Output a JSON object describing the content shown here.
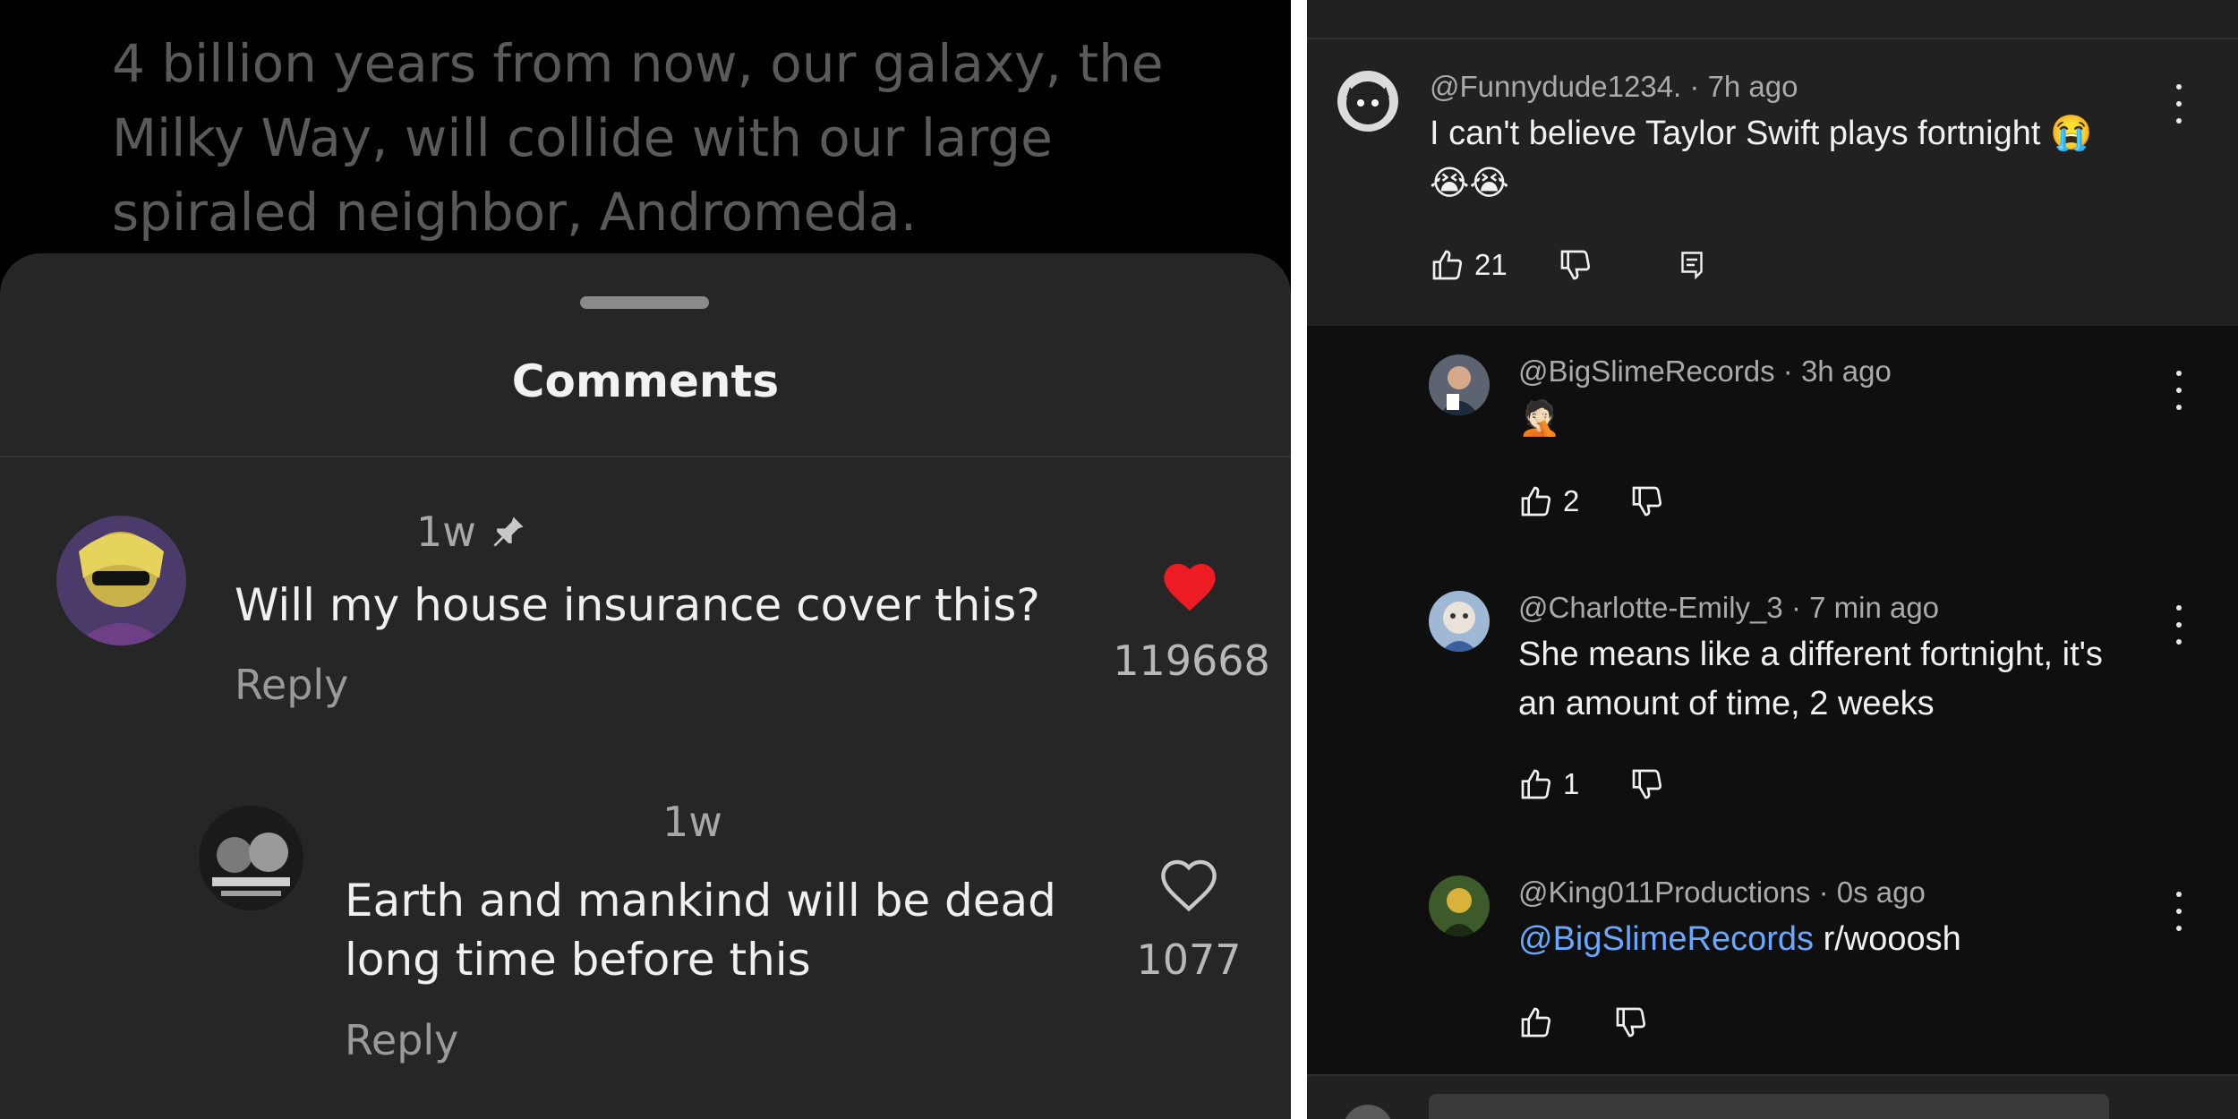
{
  "left": {
    "post_text": "4 billion years from now, our galaxy, the Milky Way, will collide with our large spiraled neighbor, Andromeda.",
    "sheet_title": "Comments",
    "comments": [
      {
        "time": "1w",
        "text": "Will my house insurance cover this?",
        "reply_label": "Reply",
        "likes": "119668",
        "liked": true
      },
      {
        "time": "1w",
        "text": "Earth and mankind will be dead long time before this",
        "reply_label": "Reply",
        "likes": "1077",
        "liked": false
      }
    ],
    "colors": {
      "heart": "#ed1c24",
      "sheet": "#262626"
    }
  },
  "right": {
    "thread": {
      "author": "@Funnydude1234.",
      "time": "7h ago",
      "text_line1": "I can't believe Taylor Swift plays fortnight 😭",
      "text_line2": "😭😭",
      "likes": "21"
    },
    "replies": [
      {
        "author": "@BigSlimeRecords",
        "time": "3h ago",
        "text": "🤦🏻",
        "likes": "2"
      },
      {
        "author": "@Charlotte-Emily_3",
        "time": "7 min ago",
        "text_line1": "She means like a different fortnight, it's",
        "text_line2": "an amount of time, 2 weeks",
        "likes": "1"
      },
      {
        "author": "@King011Productions",
        "time": "0s ago",
        "mention": "@BigSlimeRecords",
        "text": "r/wooosh",
        "likes": ""
      }
    ],
    "colors": {
      "mention": "#6aa7ff",
      "background": "#212121"
    }
  }
}
